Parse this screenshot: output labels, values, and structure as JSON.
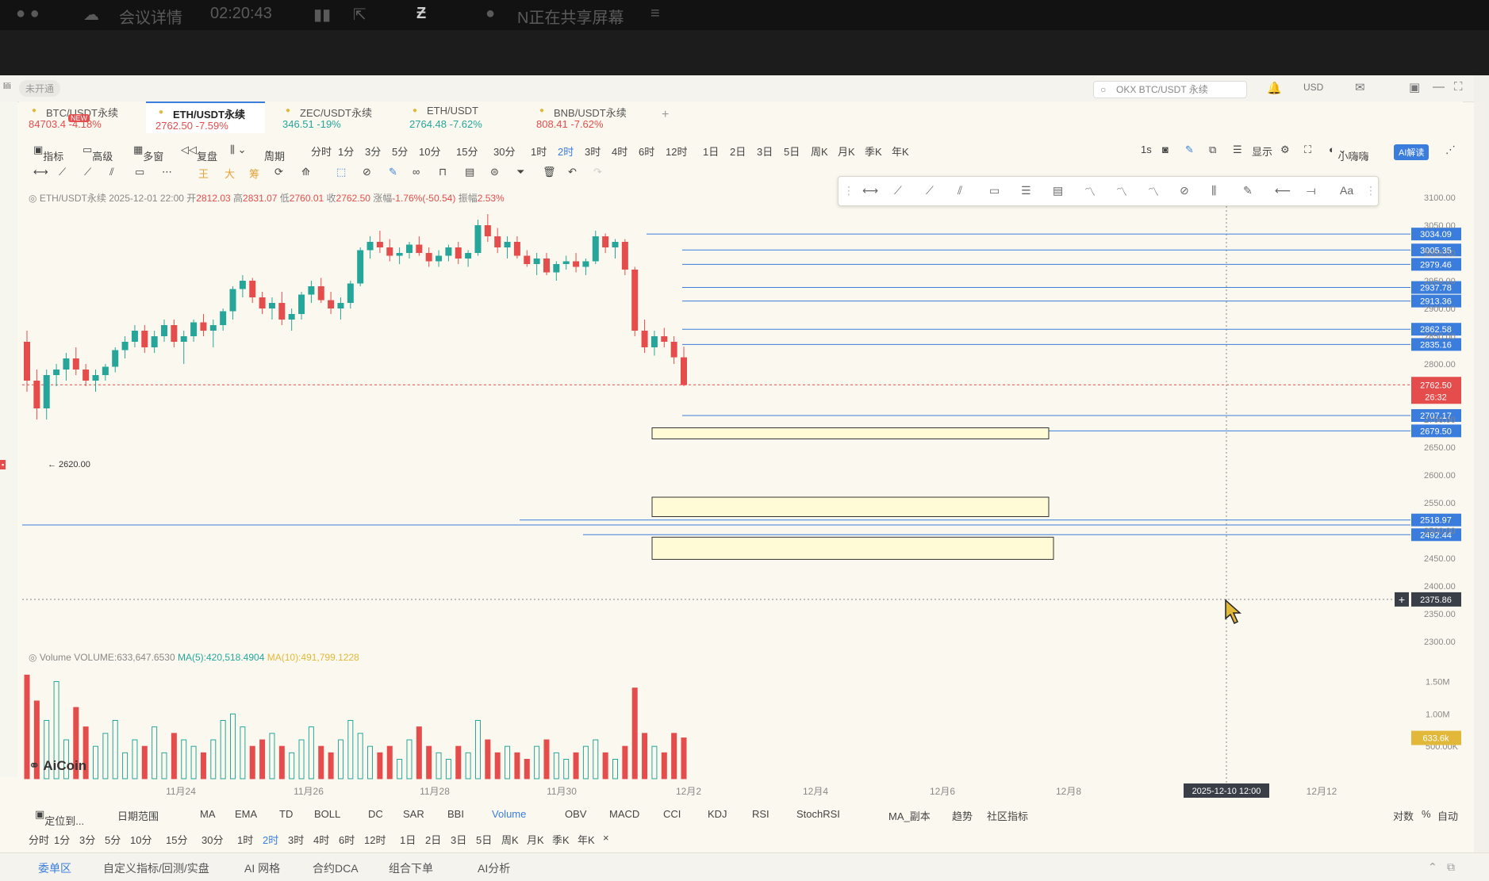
{
  "meeting": {
    "title": "会议详情",
    "time": "02:20:43",
    "share": "N正在共享屏幕"
  },
  "appbar": {
    "status": "未开通",
    "search_placeholder": "OKX BTC/USDT 永续",
    "currency": "USD"
  },
  "tabs": [
    {
      "name": "BTC/USDT永续",
      "price": "84703.4",
      "change": "-4.18%",
      "badge": "NEW"
    },
    {
      "name": "ETH/USDT永续",
      "price": "2762.50",
      "change": "-7.59%"
    },
    {
      "name": "ZEC/USDT永续",
      "price": "346.51",
      "change": "-19%"
    },
    {
      "name": "ETH/USDT",
      "price": "2764.48",
      "change": "-7.62%"
    },
    {
      "name": "BNB/USDT永续",
      "price": "808.41",
      "change": "-7.62%"
    }
  ],
  "toolbar": {
    "indicator": "指标",
    "advanced": "高级",
    "multi": "多窗",
    "replay": "复盘",
    "period": "周期",
    "periods": [
      "分时",
      "1分",
      "3分",
      "5分",
      "10分",
      "15分",
      "30分",
      "1时",
      "2时",
      "3时",
      "4时",
      "6时",
      "12时",
      "1日",
      "2日",
      "3日",
      "5日",
      "周K",
      "月K",
      "季K",
      "年K"
    ],
    "selected_period": "2时",
    "right": {
      "interval": "1s",
      "display": "显示",
      "user": "小嗨嗨",
      "ai": "AI解读"
    },
    "draw_colors": [
      "王",
      "大",
      "筹"
    ]
  },
  "info_line": {
    "symbol": "ETH/USDT永续",
    "datetime": "2025-12-01 22:00",
    "open_label": "开",
    "open": "2812.03",
    "high_label": "高",
    "high": "2831.07",
    "low_label": "低",
    "low": "2760.01",
    "close_label": "收",
    "close": "2762.50",
    "change_label": "涨幅",
    "change": "-1.76%(-50.54)",
    "amplitude_label": "振幅",
    "amplitude": "2.53%"
  },
  "price_axis": [
    "3100.00",
    "3050.00",
    "3000.00",
    "2950.00",
    "2900.00",
    "2850.00",
    "2800.00",
    "2750.00",
    "2700.00",
    "2650.00",
    "2600.00",
    "2550.00",
    "2500.00",
    "2450.00",
    "2400.00",
    "2350.00",
    "2300.00"
  ],
  "level_tags": [
    "3034.09",
    "3005.35",
    "2979.46",
    "2937.78",
    "2913.36",
    "2862.58",
    "2835.16",
    "2707.17",
    "2679.50",
    "2518.97",
    "2492.44"
  ],
  "current_price": "2762.50",
  "countdown": "26:32",
  "crosshair_price": "2375.86",
  "low_marker": "2620.00",
  "volume_legend": {
    "label": "Volume",
    "volume": "VOLUME:633,647.6530",
    "ma5": "MA(5):420,518.4904",
    "ma10": "MA(10):491,799.1228"
  },
  "volume_axis": [
    "1.50M",
    "1.00M",
    "500.00K"
  ],
  "volume_tag": "633.6k",
  "date_axis": [
    "11月24",
    "11月26",
    "11月28",
    "11月30",
    "12月2",
    "12月4",
    "12月6",
    "12月8",
    "12月12"
  ],
  "crosshair_date": "2025-12-10 12:00",
  "brand": "AiCoin",
  "indicator_row": {
    "locate": "定位到...",
    "date_range": "日期范围",
    "items": [
      "MA",
      "EMA",
      "TD",
      "BOLL",
      "DC",
      "SAR",
      "BBI",
      "Volume",
      "OBV",
      "MACD",
      "CCI",
      "KDJ",
      "RSI",
      "StochRSI",
      "MA_副本",
      "趋势",
      "社区指标"
    ],
    "right": [
      "对数",
      "%",
      "自动"
    ],
    "active": "Volume"
  },
  "bottom_periods": [
    "分时",
    "1分",
    "3分",
    "5分",
    "10分",
    "15分",
    "30分",
    "1时",
    "2时",
    "3时",
    "4时",
    "6时",
    "12时",
    "1日",
    "2日",
    "3日",
    "5日",
    "周K",
    "月K",
    "季K",
    "年K",
    "×"
  ],
  "bottom_tabs": [
    "委单区",
    "自定义指标/回测/实盘",
    "AI 网格",
    "合约DCA",
    "组合下单",
    "AI分析"
  ],
  "colors": {
    "up": "#26a69a",
    "down": "#e54c4c",
    "accent": "#3b7ddd",
    "level_line": "#3b7ddd",
    "volume_ma5": "#e6c447"
  },
  "chart_data": {
    "type": "candlestick",
    "interval": "2h",
    "symbol": "ETH/USDT永续",
    "ylim": [
      2300,
      3100
    ],
    "ohlc": [
      [
        2840,
        2860,
        2750,
        2770
      ],
      [
        2770,
        2790,
        2700,
        2720
      ],
      [
        2720,
        2790,
        2700,
        2780
      ],
      [
        2780,
        2800,
        2760,
        2790
      ],
      [
        2790,
        2820,
        2770,
        2810
      ],
      [
        2810,
        2830,
        2780,
        2790
      ],
      [
        2790,
        2800,
        2760,
        2770
      ],
      [
        2770,
        2790,
        2750,
        2780
      ],
      [
        2780,
        2800,
        2770,
        2795
      ],
      [
        2795,
        2830,
        2785,
        2825
      ],
      [
        2825,
        2850,
        2810,
        2840
      ],
      [
        2840,
        2870,
        2830,
        2860
      ],
      [
        2860,
        2870,
        2820,
        2830
      ],
      [
        2830,
        2860,
        2820,
        2850
      ],
      [
        2850,
        2880,
        2840,
        2870
      ],
      [
        2870,
        2880,
        2830,
        2840
      ],
      [
        2840,
        2860,
        2800,
        2850
      ],
      [
        2850,
        2880,
        2840,
        2875
      ],
      [
        2875,
        2890,
        2850,
        2860
      ],
      [
        2860,
        2880,
        2830,
        2870
      ],
      [
        2870,
        2900,
        2860,
        2895
      ],
      [
        2895,
        2940,
        2880,
        2935
      ],
      [
        2935,
        2960,
        2920,
        2950
      ],
      [
        2950,
        2955,
        2910,
        2920
      ],
      [
        2920,
        2930,
        2890,
        2900
      ],
      [
        2900,
        2920,
        2880,
        2910
      ],
      [
        2910,
        2930,
        2870,
        2880
      ],
      [
        2880,
        2900,
        2860,
        2890
      ],
      [
        2890,
        2930,
        2880,
        2925
      ],
      [
        2925,
        2950,
        2910,
        2940
      ],
      [
        2940,
        2955,
        2910,
        2915
      ],
      [
        2915,
        2930,
        2890,
        2900
      ],
      [
        2900,
        2920,
        2880,
        2910
      ],
      [
        2910,
        2950,
        2900,
        2945
      ],
      [
        2945,
        3010,
        2940,
        3005
      ],
      [
        3005,
        3030,
        2990,
        3020
      ],
      [
        3020,
        3040,
        3000,
        3010
      ],
      [
        3010,
        3025,
        2985,
        2995
      ],
      [
        2995,
        3010,
        2980,
        3000
      ],
      [
        3000,
        3020,
        2990,
        3015
      ],
      [
        3015,
        3030,
        2995,
        3000
      ],
      [
        3000,
        3010,
        2975,
        2985
      ],
      [
        2985,
        3005,
        2975,
        2995
      ],
      [
        2995,
        3015,
        2985,
        3010
      ],
      [
        3010,
        3020,
        2980,
        2990
      ],
      [
        2990,
        3005,
        2975,
        3000
      ],
      [
        3000,
        3060,
        2995,
        3050
      ],
      [
        3050,
        3070,
        3020,
        3030
      ],
      [
        3030,
        3045,
        3000,
        3010
      ],
      [
        3010,
        3030,
        2990,
        3020
      ],
      [
        3020,
        3030,
        2990,
        2995
      ],
      [
        2995,
        3005,
        2975,
        2980
      ],
      [
        2980,
        3000,
        2960,
        2990
      ],
      [
        2990,
        3000,
        2960,
        2965
      ],
      [
        2965,
        2985,
        2950,
        2980
      ],
      [
        2980,
        2995,
        2970,
        2985
      ],
      [
        2985,
        3000,
        2965,
        2975
      ],
      [
        2975,
        2990,
        2960,
        2985
      ],
      [
        2985,
        3040,
        2980,
        3030
      ],
      [
        3030,
        3035,
        3000,
        3010
      ],
      [
        3010,
        3025,
        2990,
        3020
      ],
      [
        3020,
        3025,
        2960,
        2970
      ],
      [
        2970,
        2975,
        2850,
        2860
      ],
      [
        2860,
        2880,
        2820,
        2830
      ],
      [
        2830,
        2860,
        2815,
        2850
      ],
      [
        2850,
        2865,
        2830,
        2840
      ],
      [
        2840,
        2850,
        2800,
        2812
      ],
      [
        2812,
        2831,
        2760,
        2762
      ]
    ],
    "volume": [
      1.6,
      1.2,
      0.9,
      1.5,
      0.6,
      1.1,
      0.8,
      0.5,
      0.7,
      0.9,
      0.4,
      0.6,
      0.5,
      0.8,
      0.4,
      0.7,
      0.6,
      0.5,
      0.4,
      0.6,
      0.9,
      1.0,
      0.8,
      0.5,
      0.6,
      0.7,
      0.5,
      0.4,
      0.6,
      0.8,
      0.5,
      0.4,
      0.6,
      0.9,
      0.7,
      0.5,
      0.4,
      0.5,
      0.3,
      0.6,
      0.8,
      0.5,
      0.4,
      0.3,
      0.5,
      0.4,
      0.9,
      0.6,
      0.4,
      0.5,
      0.4,
      0.3,
      0.5,
      0.6,
      0.4,
      0.3,
      0.4,
      0.5,
      0.6,
      0.4,
      0.3,
      0.5,
      1.4,
      0.7,
      0.5,
      0.4,
      0.7,
      0.63
    ],
    "levels": [
      3034.09,
      3005.35,
      2979.46,
      2937.78,
      2913.36,
      2862.58,
      2835.16,
      2707.17,
      2679.5,
      2518.97,
      2492.44
    ],
    "zones": [
      [
        2685,
        2665
      ],
      [
        2560,
        2525
      ],
      [
        2488,
        2448
      ]
    ]
  }
}
